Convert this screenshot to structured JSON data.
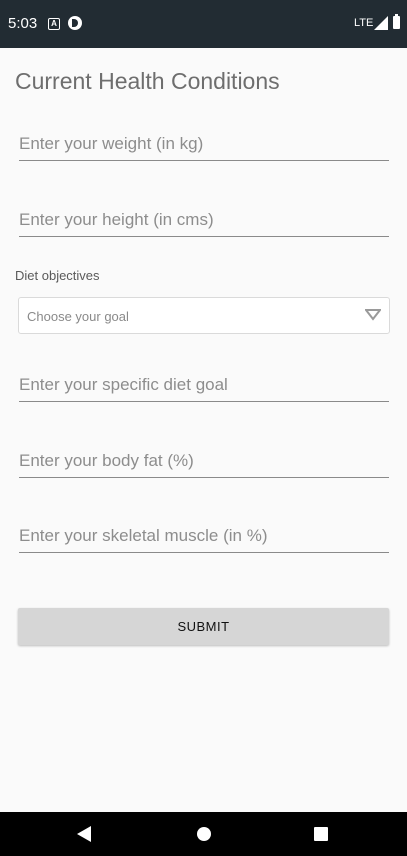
{
  "status_bar": {
    "time": "5:03",
    "network": "LTE",
    "notification_icons": [
      "a-box-icon",
      "circle-icon"
    ]
  },
  "page": {
    "title": "Current Health Conditions"
  },
  "form": {
    "weight_placeholder": "Enter your weight (in kg)",
    "height_placeholder": "Enter your height (in cms)",
    "diet_objectives_label": "Diet objectives",
    "goal_select_value": "Choose your goal",
    "specific_goal_placeholder": "Enter your specific diet goal",
    "body_fat_placeholder": "Enter your body fat (%)",
    "skeletal_muscle_placeholder": "Enter your skeletal muscle (in %)",
    "submit_label": "SUBMIT"
  },
  "colors": {
    "status_bar": "#222c33",
    "background": "#fafafa",
    "button": "#d6d6d6"
  }
}
